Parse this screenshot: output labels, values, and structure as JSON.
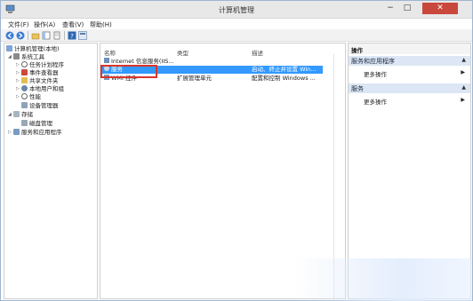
{
  "window": {
    "title": "计算机管理"
  },
  "window_controls": {
    "minimize": "−",
    "maximize": "□",
    "close": "✕"
  },
  "menu": [
    {
      "label": "文件(F)"
    },
    {
      "label": "操作(A)"
    },
    {
      "label": "查看(V)"
    },
    {
      "label": "帮助(H)"
    }
  ],
  "tree": {
    "root": "计算机管理(本地)",
    "system_tools": "系统工具",
    "task_scheduler": "任务计划程序",
    "event_viewer": "事件查看器",
    "shared_folders": "共享文件夹",
    "local_users": "本地用户和组",
    "performance": "性能",
    "device_manager": "设备管理器",
    "storage": "存储",
    "disk_management": "磁盘管理",
    "services_apps": "服务和应用程序"
  },
  "list": {
    "columns": {
      "name": "名称",
      "type": "类型",
      "description": "描述"
    },
    "rows": [
      {
        "name": "Internet 信息服务(IIS...",
        "type": "",
        "description": ""
      },
      {
        "name": "服务",
        "type": "",
        "description": "启动、终止并设置 Win..."
      },
      {
        "name": "WMI 控件",
        "type": "扩展管理单元",
        "description": "配置和控制 Windows ..."
      }
    ]
  },
  "actions": {
    "title": "操作",
    "group1": "服务和应用程序",
    "group1_more": "更多操作",
    "group2": "服务",
    "group2_more": "更多操作"
  },
  "colors": {
    "selection": "#3399ff",
    "highlight_box": "#d9352c",
    "close_button": "#c9483c",
    "action_group": "#dce6f4"
  }
}
